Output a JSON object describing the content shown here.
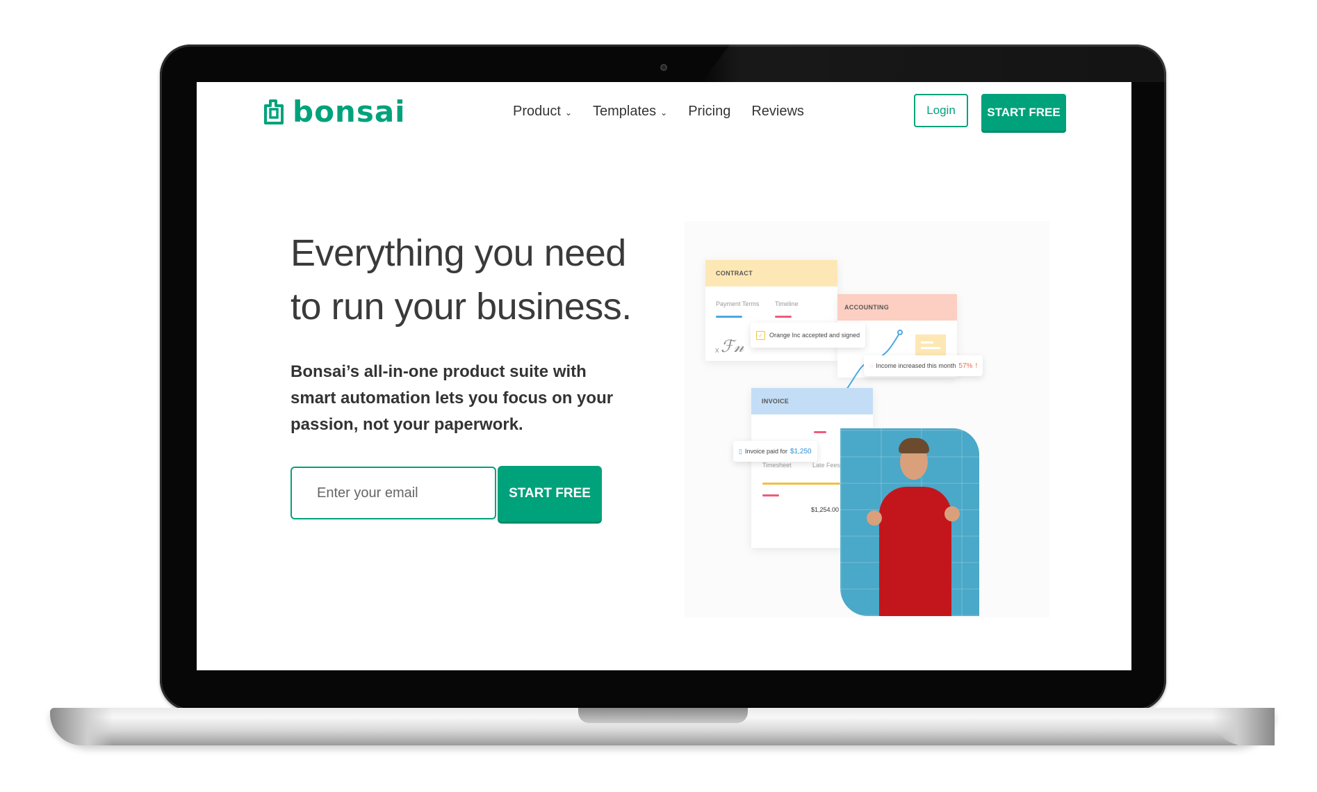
{
  "brand": {
    "name": "bonsai",
    "color": "#00a27b"
  },
  "nav": {
    "items": [
      {
        "label": "Product",
        "has_dropdown": true
      },
      {
        "label": "Templates",
        "has_dropdown": true
      },
      {
        "label": "Pricing",
        "has_dropdown": false
      },
      {
        "label": "Reviews",
        "has_dropdown": false
      }
    ],
    "login_label": "Login",
    "start_label": "START FREE"
  },
  "hero": {
    "title": "Everything you need to run your business.",
    "subtitle": "Bonsai’s all-in-one product suite with smart automation lets you focus on your passion, not your paperwork.",
    "email_placeholder": "Enter your email",
    "cta_label": "START FREE"
  },
  "illustration": {
    "contract": {
      "header": "CONTRACT",
      "col1": "Payment Terms",
      "col2": "Timeline",
      "signature": "x",
      "signature_mark": "ℱ𝓃",
      "header_color": "#fde8b5"
    },
    "accounting": {
      "header": "ACCOUNTING",
      "header_color": "#fccfc2"
    },
    "invoice": {
      "header": "INVOICE",
      "col1": "Timesheet",
      "col2": "Late Fees",
      "amount": "$1,254.00",
      "header_color": "#c3ddf6"
    },
    "notifications": {
      "accepted": "Orange Inc accepted and signed",
      "income_text": "Income increased this month",
      "income_value": "57%",
      "income_suffix": "!",
      "paid_text": "Invoice paid for",
      "paid_value": "$1,250"
    }
  }
}
